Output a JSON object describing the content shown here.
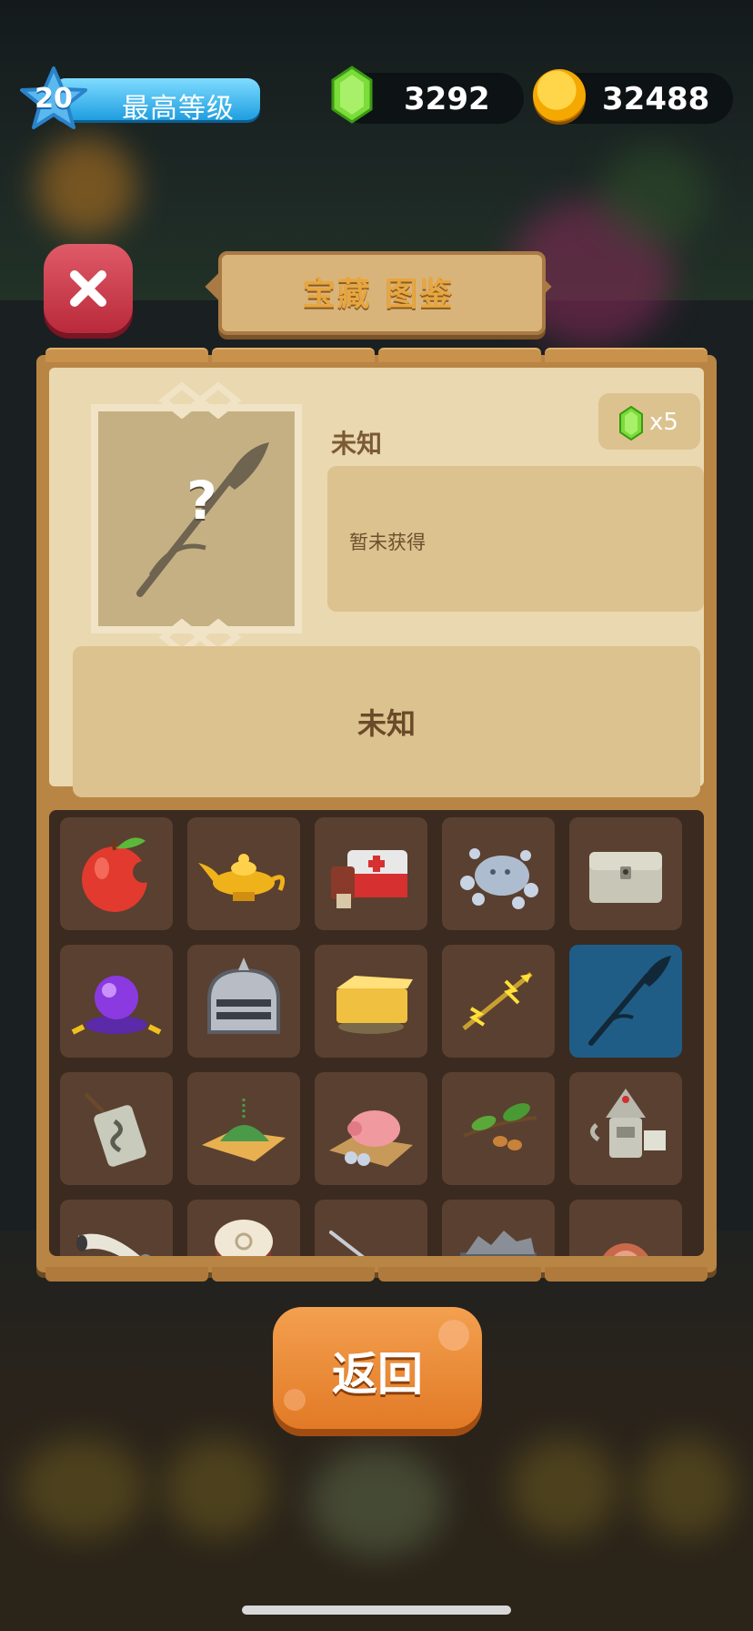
{
  "hud": {
    "level": "20",
    "level_label": "最高等级",
    "gems": "3292",
    "gold": "32488"
  },
  "dialog": {
    "title": "宝藏 图鉴",
    "item_name": "未知",
    "cost_multiplier": "x5",
    "status": "暂未获得",
    "description": "未知"
  },
  "grid_items": [
    "bitten-apple-icon",
    "magic-lamp-icon",
    "first-aid-kit-icon",
    "coin-slime-icon",
    "stone-chest-icon",
    "crystal-ball-icon",
    "knight-helmet-icon",
    "cheese-block-icon",
    "lightning-arrow-icon",
    "spear-silhouette-icon",
    "rune-tablet-icon",
    "herb-pile-icon",
    "piggy-bank-icon",
    "almond-branch-icon",
    "wizard-robot-icon",
    "horn-icon",
    "war-drum-icon",
    "needle-icon",
    "ore-cart-icon",
    "meat-icon"
  ],
  "selected_index": 9,
  "back_label": "返回",
  "colors": {
    "panel": "#b98544",
    "parchment": "#ead8b0",
    "accent_orange": "#e27a26",
    "close_red": "#c63646",
    "selected_cell": "#1f5d86"
  }
}
